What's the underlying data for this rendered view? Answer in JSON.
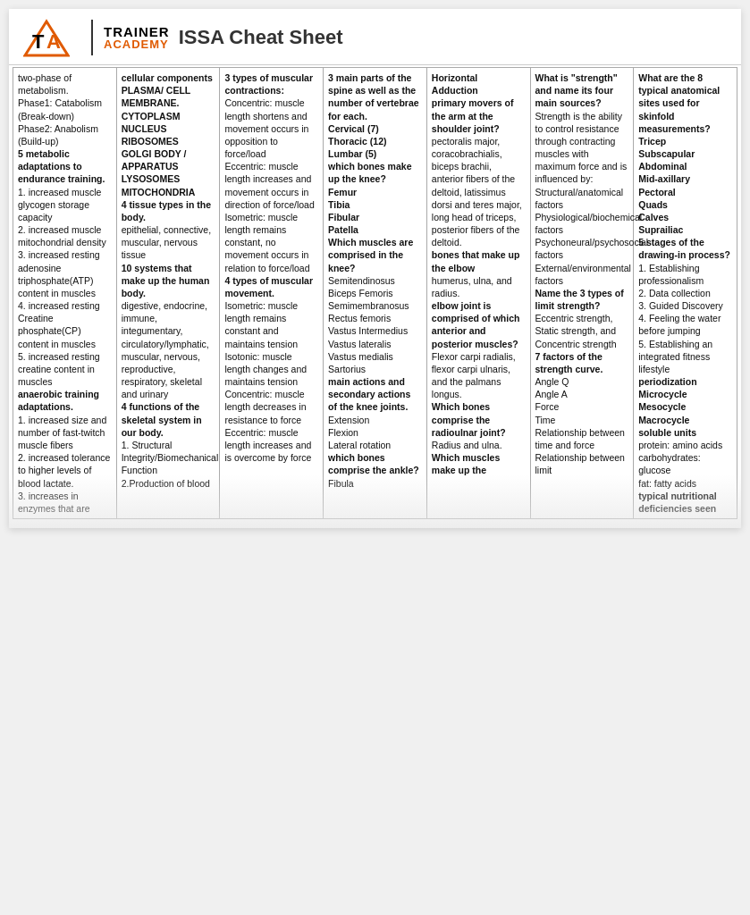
{
  "header": {
    "logo_trainer": "TRAINER",
    "logo_academy": "ACADEMY",
    "title": "ISSA Cheat Sheet"
  },
  "columns": [
    {
      "id": "col1",
      "content": "two-phase of metabolism.\nPhase1: Catabolism (Break-down)\nPhase2: Anabolism (Build-up)\n5 metabolic adaptations to endurance training.\n1. increased muscle glycogen storage capacity\n2. increased muscle mitochondrial density\n3. increased resting adenosine triphosphate(ATP) content in muscles\n4. increased resting Creatine phosphate(CP) content in muscles\n5. increased resting creatine content in muscles\nanaerobic training adaptations.\n1. increased size and number of fast-twitch muscle fibers\n2. increased tolerance to higher levels of blood lactate.\n3. increases in enzymes that are"
    },
    {
      "id": "col2",
      "content": "cellular components\nPLASMA/ CELL MEMBRANE.\nCYTOPLASM\nNUCLEUS\nRIBOSOMES\nGOLGI BODY / APPARATUS\nLYSOSOMES\nMITOCHONDRIA\n4 tissue types in the body.\nepithelial, connective, muscular, nervous tissue\n10 systems that make up the human body.\ndigestive, endocrine, immune, integumentary, circulatory/lymphatic, muscular, nervous, reproductive, respiratory, skeletal and urinary\n4 functions of the skeletal system in our body.\n1. Structural Integrity/Biomechanical Function\n2.Production of blood"
    },
    {
      "id": "col3",
      "content": "3 types of muscular contractions:\nConcentric: muscle length shortens and movement occurs in opposition to force/load\nEccentric: muscle length increases and movement occurs in direction of force/load\nIsometric: muscle length remains constant, no movement occurs in relation to force/load\n4 types of muscular movement.\nIsometric: muscle length remains constant and maintains tension\nIsotonic: muscle length changes and maintains tension\nConcentric: muscle length decreases in resistance to force\nEccentric: muscle length increases and is overcome by force"
    },
    {
      "id": "col4",
      "content": "3 main parts of the spine as well as the number of vertebrae for each.\nCervical (7)\nThoracic (12)\nLumbar (5)\nwhich bones make up the knee?\nFemur\nTibia\nFibular\nPatella\nWhich muscles are comprised in the knee?\nSemitendinosus\nBiceps Femoris\nSemimembranosus\nRectus femoris\nVastus Intermedius\nVastus lateralis\nVastus medialis\nSartorius\nmain actions and secondary actions of the knee joints.\nExtension\nFlexion\nLateral rotation\nwhich bones comprise the ankle?\nFibula"
    },
    {
      "id": "col5",
      "content": "Horizontal Adduction\nprimary movers of the arm at the shoulder joint?\npectoralis major, coracobrachialis, biceps brachii, anterior fibers of the deltoid, latissimus dorsi and teres major, long head of triceps, posterior fibers of the deltoid.\nbones that make up the elbow\nhumerus, ulna, and radius.\nelbow joint is comprised of which anterior and posterior muscles?\nFlexor carpi radialis, flexor carpi ulnaris, and the palmans longus.\nWhich bones comprise the radioulnar joint?\nRadius and ulna.\nWhich muscles make up the"
    },
    {
      "id": "col6",
      "content": "What is \"strength\" and name its four main sources?\nStrength is the ability to control resistance through contracting muscles with maximum force and is influenced by:\nStructural/anatomical factors\nPhysiological/biochemical factors\nPsychoneural/psychosocial factors\nExternal/environmental factors\nName the 3 types of limit strength?\nEccentric strength, Static strength, and Concentric strength\n7 factors of the strength curve.\nAngle Q\nAngle A\nForce\nTime\nRelationship between time and force\nRelationship between limit"
    },
    {
      "id": "col7",
      "content": "What are the 8 typical anatomical sites used for skinfold measurements?\nTricep\nSubscapular\nAbdominal\nMid-axillary\nPectoral\nQuads\nCalves\nSuprailiac\n5 stages of the drawing-in process?\n1. Establishing professionalism\n2. Data collection\n3. Guided Discovery\n4. Feeling the water before jumping\n5. Establishing an integrated fitness lifestyle\nperiodization\nMicrocycle\nMesocycle\nMacrocycle\nsoluble units\nprotein: amino acids\ncarbohydrates: glucose\nfat: fatty acids\ntypical nutritional deficiencies seen"
    }
  ]
}
